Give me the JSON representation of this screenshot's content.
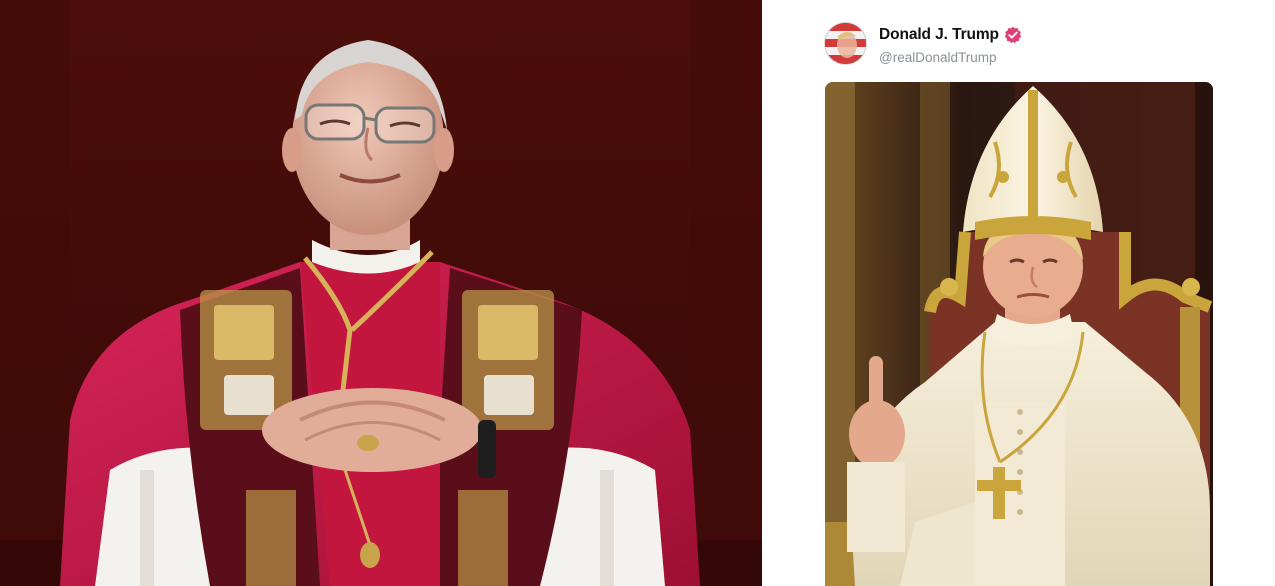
{
  "post": {
    "display_name": "Donald J. Trump",
    "handle": "@realDonaldTrump",
    "verified_icon": "verified-badge-icon",
    "verified_color": "#e0407a",
    "avatar_icon": "flag-portrait-avatar"
  },
  "left_photo": {
    "description_icon": "cardinal-balcony-photo",
    "background_color": "#4a0f0c",
    "robe_color": "#c0143c"
  },
  "post_image": {
    "description_icon": "papal-portrait-image",
    "robe_color": "#efe6cf",
    "gold_color": "#c9a53c"
  }
}
